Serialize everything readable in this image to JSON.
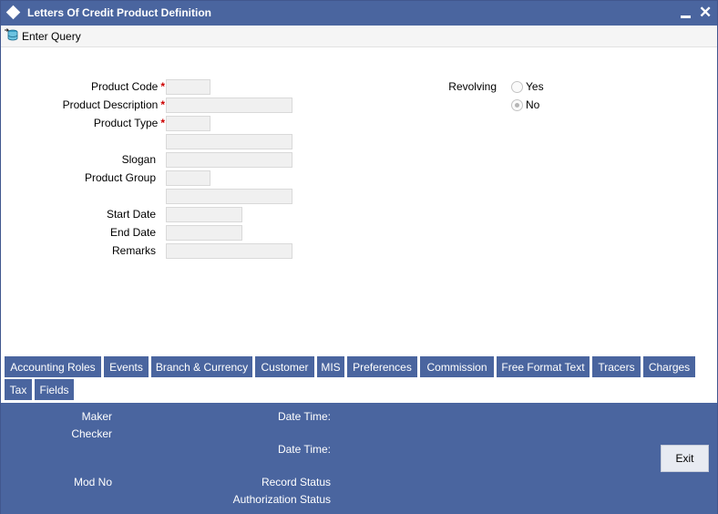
{
  "window": {
    "title": "Letters Of Credit Product Definition",
    "minimize": "_",
    "close": "✕"
  },
  "toolbar": {
    "enter_query": "Enter Query"
  },
  "form": {
    "product_code": "Product Code",
    "product_description": "Product Description",
    "product_type": "Product Type",
    "slogan": "Slogan",
    "product_group": "Product Group",
    "start_date": "Start Date",
    "end_date": "End Date",
    "remarks": "Remarks",
    "required_mark": "*",
    "revolving": {
      "label": "Revolving",
      "yes": "Yes",
      "no": "No",
      "selected": "No"
    }
  },
  "tabs": {
    "row1": [
      "Accounting Roles",
      "Events",
      "Branch & Currency",
      "Customer",
      "MIS",
      "Preferences",
      "Commission",
      "Free Format Text",
      "Tracers",
      "Charges"
    ],
    "row2": [
      "Tax",
      "Fields"
    ]
  },
  "footer": {
    "maker": "Maker",
    "checker": "Checker",
    "mod_no": "Mod No",
    "date_time_1": "Date Time:",
    "date_time_2": "Date Time:",
    "record_status": "Record Status",
    "authorization_status": "Authorization Status",
    "exit": "Exit"
  },
  "colors": {
    "title_bar": "#4a659f",
    "required": "#cc0000"
  },
  "icons": {
    "title": "diamond-icon",
    "query": "enter-query-icon"
  }
}
